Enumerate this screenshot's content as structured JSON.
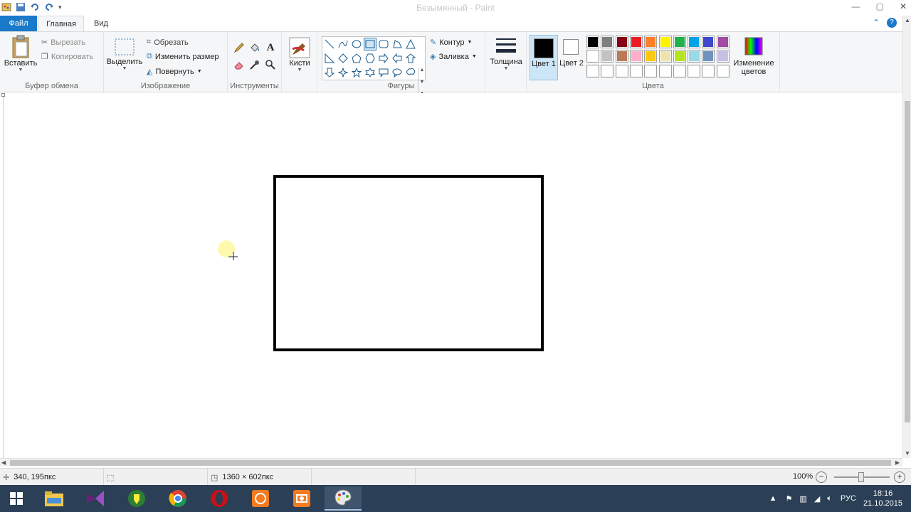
{
  "window": {
    "title": "Безымянный - Paint",
    "controls": [
      "minimize-button",
      "maximize-button",
      "close-button"
    ]
  },
  "tabs": {
    "file": "Файл",
    "home": "Главная",
    "view": "Вид"
  },
  "ribbon": {
    "clipboard": {
      "paste": "Вставить",
      "cut": "Вырезать",
      "copy": "Копировать",
      "label": "Буфер обмена"
    },
    "image": {
      "select": "Выделить",
      "crop": "Обрезать",
      "resize": "Изменить размер",
      "rotate": "Повернуть",
      "label": "Изображение"
    },
    "tools": {
      "label": "Инструменты",
      "items": [
        "pencil-icon",
        "fill-icon",
        "text-icon",
        "eraser-icon",
        "color-picker-icon",
        "magnifier-icon"
      ]
    },
    "brushes": {
      "label": "Кисти"
    },
    "shapes": {
      "label": "Фигуры",
      "outline": "Контур",
      "fill": "Заливка",
      "selected": "rectangle"
    },
    "size": {
      "label": "Толщина"
    },
    "colors": {
      "color1_label": "Цвет 1",
      "color1_value": "#000000",
      "color2_label": "Цвет 2",
      "color2_value": "#ffffff",
      "edit_label": "Изменение цветов",
      "label": "Цвета",
      "palette": [
        "#000000",
        "#7f7f7f",
        "#880015",
        "#ed1c24",
        "#ff7f27",
        "#fff200",
        "#22b14c",
        "#00a2e8",
        "#3f48cc",
        "#a349a4",
        "#ffffff",
        "#c3c3c3",
        "#b97a57",
        "#ffaec9",
        "#ffc90e",
        "#efe4b0",
        "#b5e61d",
        "#99d9ea",
        "#7092be",
        "#c8bfe7",
        "#ffffff",
        "#ffffff",
        "#ffffff",
        "#ffffff",
        "#ffffff",
        "#ffffff",
        "#ffffff",
        "#ffffff",
        "#ffffff",
        "#ffffff"
      ]
    }
  },
  "status": {
    "cursor_pos": "340, 195пкс",
    "canvas_size": "1360 × 602пкс",
    "zoom": "100%"
  },
  "taskbar": {
    "language": "РУС",
    "time": "18:16",
    "date": "21.10.2015"
  }
}
